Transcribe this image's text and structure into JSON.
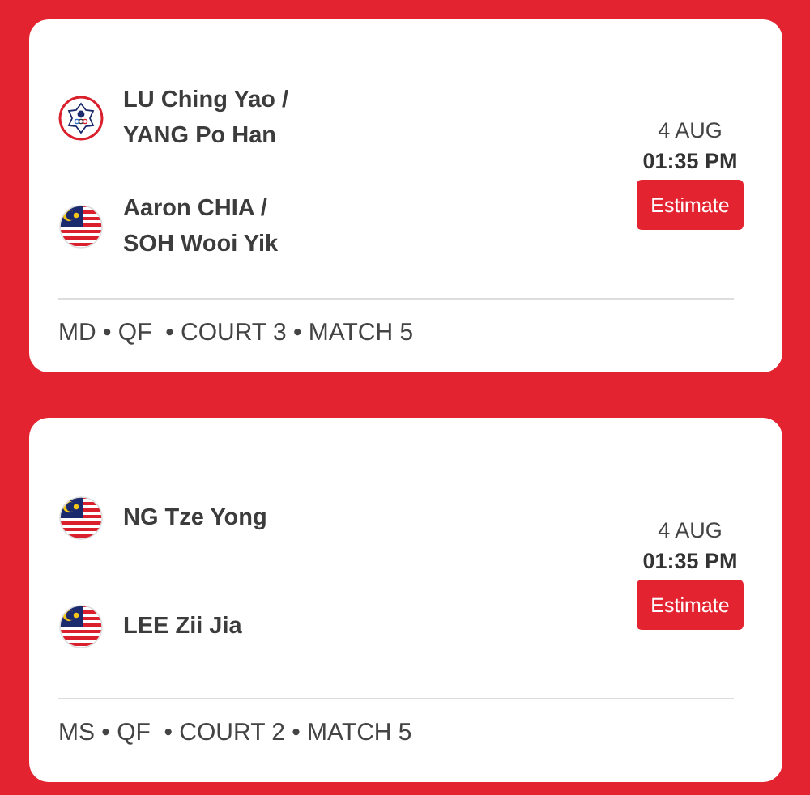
{
  "matches": [
    {
      "teams": [
        {
          "kind": "taipei",
          "players": [
            "LU Ching Yao /",
            "YANG Po Han"
          ]
        },
        {
          "kind": "malaysia",
          "players": [
            "Aaron CHIA /",
            "SOH Wooi Yik"
          ]
        }
      ],
      "date": "4 AUG",
      "time": "01:35 PM",
      "button": "Estimate",
      "meta": "MD • QF  • COURT 3 • MATCH 5"
    },
    {
      "teams": [
        {
          "kind": "malaysia",
          "players": [
            "NG Tze Yong"
          ]
        },
        {
          "kind": "malaysia",
          "players": [
            "LEE Zii Jia"
          ]
        }
      ],
      "date": "4 AUG",
      "time": "01:35 PM",
      "button": "Estimate",
      "meta": "MS • QF  • COURT 2 • MATCH 5"
    }
  ]
}
